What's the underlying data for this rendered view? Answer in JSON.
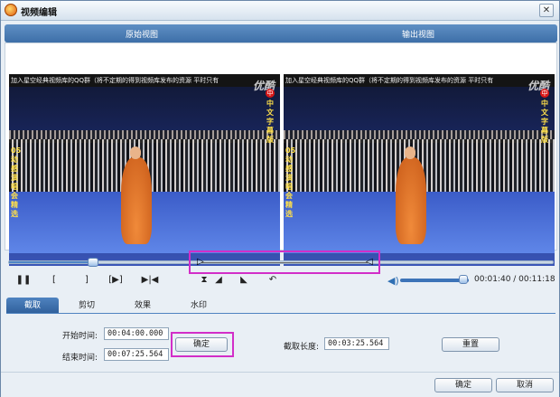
{
  "window": {
    "title": "视频编辑",
    "close": "✕"
  },
  "views": {
    "original_label": "原始视图",
    "output_label": "输出视图"
  },
  "video": {
    "top_caption": "加入星空经典视频库的QQ群（将不定期的得到视频库发布的资源 平时只有",
    "logo": "优酷",
    "left_vertical_text": "05动感演唱会精选",
    "right_vertical_text": "中文字幕版",
    "red_badge": "中"
  },
  "timeline": {
    "position_fraction": 0.155,
    "trim_start_fraction": 0.35,
    "trim_end_fraction": 0.66
  },
  "controls": {
    "buttons": [
      "❚❚",
      "[",
      "]",
      "[▶]",
      "▶|◀",
      "⧗",
      "◢",
      "◣",
      "↶"
    ],
    "volume_fraction": 0.92,
    "timecode": "00:01:40 / 00:11:18"
  },
  "tabs": [
    "截取",
    "剪切",
    "效果",
    "水印"
  ],
  "trim": {
    "start_label": "开始时间:",
    "start_value": "00:04:00.000",
    "end_label": "结束时间:",
    "end_value": "00:07:25.564",
    "confirm": "确定",
    "length_label": "截取长度:",
    "length_value": "00:03:25.564",
    "reset": "重置"
  },
  "footer": {
    "ok": "确定",
    "cancel": "取消"
  }
}
